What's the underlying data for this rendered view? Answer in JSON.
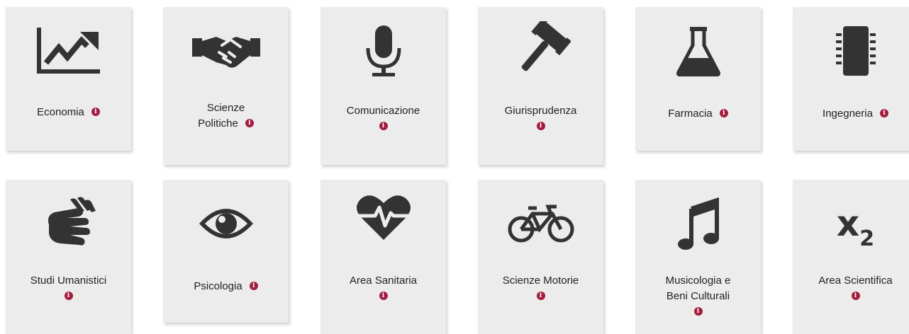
{
  "colors": {
    "card_background": "#ececec",
    "icon": "#333333",
    "info_badge": "#a41d3f"
  },
  "info_glyph": "i",
  "cards": [
    {
      "id": "economia",
      "label": "Economia",
      "icon": "chart-line-icon"
    },
    {
      "id": "scienze-politiche",
      "label_line1": "Scienze",
      "label_line2": "Politiche",
      "icon": "handshake-icon"
    },
    {
      "id": "comunicazione",
      "label": "Comunicazione",
      "icon": "microphone-icon"
    },
    {
      "id": "giurisprudenza",
      "label": "Giurisprudenza",
      "icon": "gavel-icon"
    },
    {
      "id": "farmacia",
      "label": "Farmacia",
      "icon": "flask-icon"
    },
    {
      "id": "ingegneria",
      "label": "Ingegneria",
      "icon": "microchip-icon"
    },
    {
      "id": "studi-umanistici",
      "label": "Studi Umanistici",
      "icon": "sign-language-icon"
    },
    {
      "id": "psicologia",
      "label": "Psicologia",
      "icon": "eye-icon"
    },
    {
      "id": "area-sanitaria",
      "label": "Area Sanitaria",
      "icon": "heartbeat-icon"
    },
    {
      "id": "scienze-motorie",
      "label": "Scienze Motorie",
      "icon": "bicycle-icon"
    },
    {
      "id": "musicologia",
      "label_line1": "Musicologia e",
      "label_line2": "Beni Culturali",
      "icon": "music-icon"
    },
    {
      "id": "area-scientifica",
      "label": "Area Scientifica",
      "icon_text_base": "x",
      "icon_text_sub": "2",
      "icon": "subscript-icon"
    }
  ]
}
